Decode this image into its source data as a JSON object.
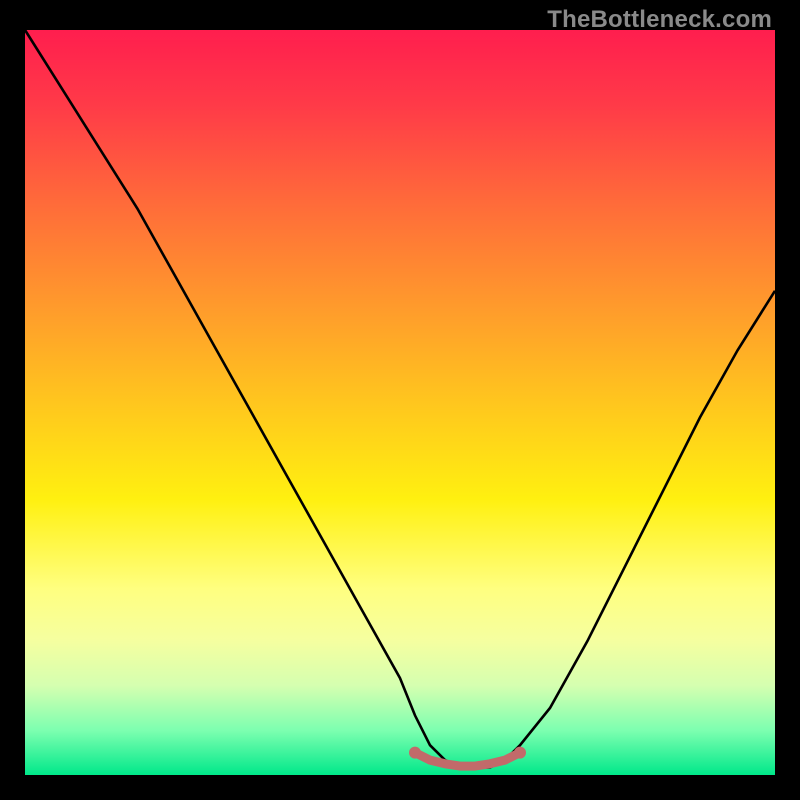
{
  "watermark": "TheBottleneck.com",
  "chart_data": {
    "type": "line",
    "title": "",
    "xlabel": "",
    "ylabel": "",
    "xlim": [
      0,
      100
    ],
    "ylim": [
      0,
      100
    ],
    "curve": {
      "name": "bottleneck-curve",
      "x": [
        0,
        5,
        10,
        15,
        20,
        25,
        30,
        35,
        40,
        45,
        50,
        52,
        54,
        56,
        58,
        60,
        62,
        64,
        66,
        70,
        75,
        80,
        85,
        90,
        95,
        100
      ],
      "y": [
        100,
        92,
        84,
        76,
        67,
        58,
        49,
        40,
        31,
        22,
        13,
        8,
        4,
        2,
        1,
        1,
        1,
        2,
        4,
        9,
        18,
        28,
        38,
        48,
        57,
        65
      ]
    },
    "flat_segment": {
      "name": "valley-marker",
      "color": "#c26a6a",
      "x": [
        52,
        54,
        56,
        58,
        60,
        62,
        64,
        66
      ],
      "y": [
        3.0,
        2.0,
        1.5,
        1.2,
        1.2,
        1.5,
        2.0,
        3.0
      ]
    }
  },
  "colors": {
    "frame": "#000000",
    "watermark": "#8a8a8a",
    "curve": "#000000",
    "valley": "#c26a6a"
  }
}
